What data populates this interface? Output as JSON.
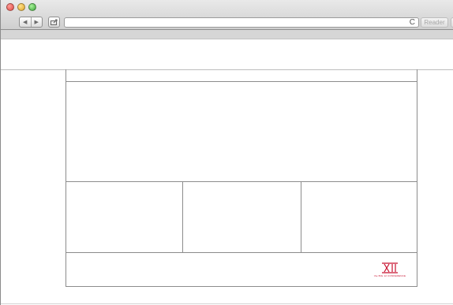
{
  "browser": {
    "back_glyph": "◀",
    "forward_glyph": "▶",
    "reload_glyph": "C",
    "reader_label": "Reader",
    "share_icon": "share-icon"
  },
  "page": {
    "logo": {
      "name": "big-12-conference-logo",
      "mark_text": "XII",
      "wordmark": "the BIG 12 CONFERENCE",
      "color": "#c8102e"
    }
  }
}
